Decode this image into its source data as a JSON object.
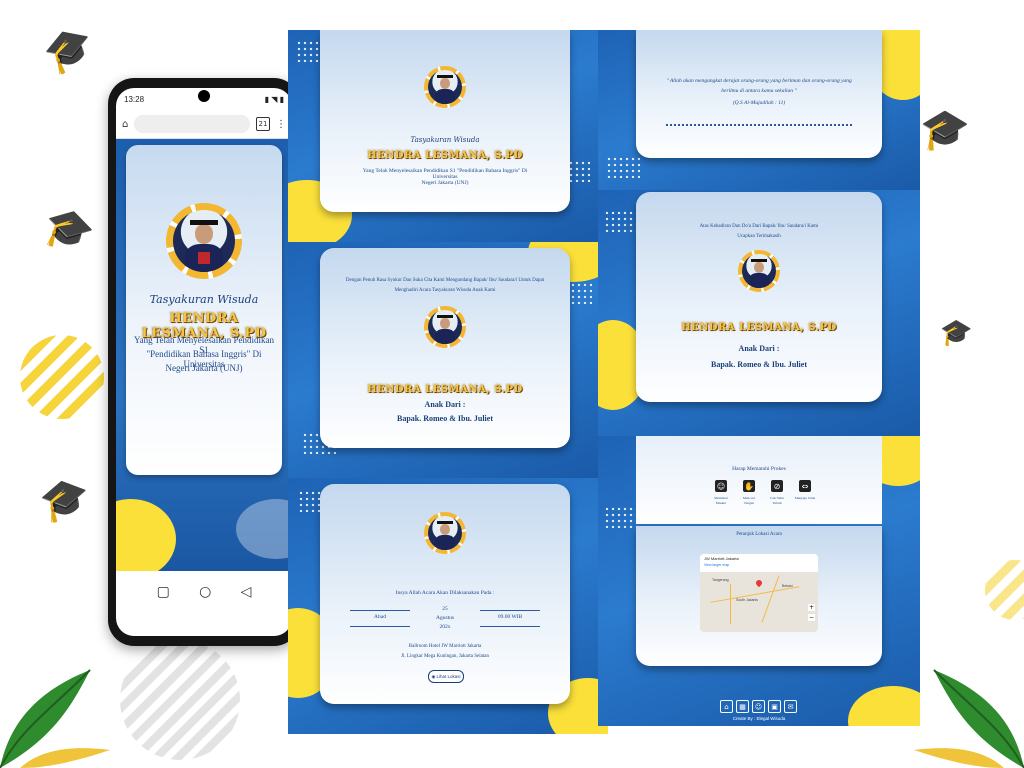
{
  "phone": {
    "time": "13:28",
    "tab_count": "21",
    "title_script": "Tasyakuran Wisuda",
    "name": "HENDRA LESMANA, S.PD",
    "line1": "Yang Telah Menyelesaikan Pendidikan S1",
    "line2": "\"Pendidikan Bahasa Inggris\" Di Universitas",
    "line3": "Negeri Jakarta (UNJ)"
  },
  "card1": {
    "title_script": "Tasyakuran Wisuda",
    "name": "HENDRA LESMANA, S.PD",
    "line1": "Yang Telah Menyelesaikan Pendidikan S1 \"Pendidikan Bahasa Inggris\" Di Universitas",
    "line2": "Negeri Jakarta (UNJ)"
  },
  "card2": {
    "intro1": "Dengan Penuh Rasa Syukur Dan Suka Cita Kami Mengundang Bapak/ Ibu/ Saudara/i Untuk Dapat",
    "intro2": "Menghadiri Acara Tasyakuran Wisuda Anak Kami",
    "name": "HENDRA LESMANA, S.PD",
    "anak_dari": "Anak Dari :",
    "parents": "Bapak. Romeo & Ibu. Juliet"
  },
  "card3": {
    "intro": "Insya Allah Acara Akan Dilaksanakan Pada :",
    "day": "Ahad",
    "date1": "25",
    "date2": "Agustus",
    "date3": "202x",
    "time": "09.00 WIB",
    "venue1": "Ballroom Hotel JW Marriott Jakarta",
    "venue2": "Jl. Lingkar Mega Kuningan, Jakarta Selatan",
    "button": "Lihat Lokasi"
  },
  "card4": {
    "quote1": "\" Allah akan mengangkat derajat orang-orang yang beriman dan orang-orang yang",
    "quote2": "berilmu di antara kamu sekalian \"",
    "source": "(Q.S Al-Mujadilah : 11)"
  },
  "card5": {
    "intro1": "Atas Kehadiran Dan Do'a Dari Bapak/ Ibu/ Saudara/i Kami",
    "intro2": "Ucapkan Terimakasih",
    "name": "HENDRA LESMANA, S.PD",
    "anak_dari": "Anak Dari :",
    "parents": "Bapak. Romeo & Ibu. Juliet"
  },
  "card6": {
    "prokes_title": "Harap Mematuhi Prokes",
    "prokes": [
      {
        "icon": "mask-icon",
        "label1": "Memakai",
        "label2": "Masker"
      },
      {
        "icon": "wash-hands-icon",
        "label1": "Mencuci",
        "label2": "Tangan"
      },
      {
        "icon": "no-touch-icon",
        "label1": "Cek Suhu",
        "label2": "Tubuh"
      },
      {
        "icon": "distance-icon",
        "label1": "Menjaga Jarak",
        "label2": ""
      }
    ],
    "map_title": "Petunjuk Lokasi Acara",
    "map_place": "JW Marriott Jakarta",
    "map_link": "View larger map",
    "map_label1": "Tangerang",
    "map_label2": "South Jakarta",
    "map_label3": "Bekasi",
    "footer": "Create By : Elegal Wisuda"
  },
  "colors": {
    "primary_blue": "#1e63b5",
    "accent_yellow": "#fbe03a",
    "gold_text": "#f6c640",
    "text_blue": "#214a8a"
  }
}
